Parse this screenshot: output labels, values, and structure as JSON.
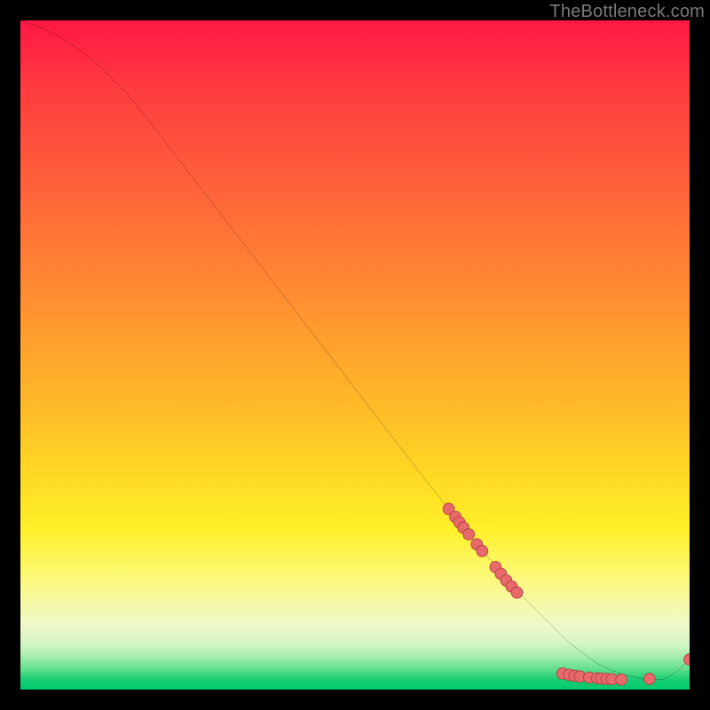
{
  "watermark": "TheBottleneck.com",
  "colors": {
    "background": "#000000",
    "curve": "#000000",
    "marker_fill": "#e86a6a",
    "marker_stroke": "#b04343"
  },
  "chart_data": {
    "type": "line",
    "title": "",
    "xlabel": "",
    "ylabel": "",
    "xlim": [
      0,
      100
    ],
    "ylim": [
      0,
      100
    ],
    "grid": false,
    "legend": false,
    "series": [
      {
        "name": "bottleneck-curve",
        "x": [
          0,
          3,
          6,
          9,
          12,
          16,
          20,
          25,
          30,
          35,
          40,
          45,
          50,
          55,
          60,
          64,
          68,
          71,
          74,
          77,
          80,
          82,
          84,
          86,
          88,
          90,
          92,
          94,
          96,
          98,
          100
        ],
        "y": [
          100,
          99,
          97.5,
          95.5,
          93,
          89,
          84,
          77.5,
          71,
          64.5,
          58,
          51.5,
          45,
          38.5,
          32,
          27,
          22,
          18.5,
          15,
          12,
          9,
          7,
          5.5,
          4,
          3,
          2.3,
          1.8,
          1.5,
          1.5,
          2.6,
          4.5
        ]
      }
    ],
    "markers": {
      "name": "highlighted-points",
      "points": [
        {
          "x": 64,
          "y": 27
        },
        {
          "x": 65,
          "y": 25.8
        },
        {
          "x": 65.6,
          "y": 25
        },
        {
          "x": 66.2,
          "y": 24.2
        },
        {
          "x": 67,
          "y": 23.2
        },
        {
          "x": 68.2,
          "y": 21.7
        },
        {
          "x": 69,
          "y": 20.7
        },
        {
          "x": 71,
          "y": 18.3
        },
        {
          "x": 71.8,
          "y": 17.3
        },
        {
          "x": 72.6,
          "y": 16.3
        },
        {
          "x": 73.4,
          "y": 15.4
        },
        {
          "x": 74.2,
          "y": 14.5
        },
        {
          "x": 81,
          "y": 2.4
        },
        {
          "x": 82,
          "y": 2.2
        },
        {
          "x": 82.8,
          "y": 2.05
        },
        {
          "x": 83.6,
          "y": 1.95
        },
        {
          "x": 85,
          "y": 1.8
        },
        {
          "x": 86.2,
          "y": 1.7
        },
        {
          "x": 86.8,
          "y": 1.65
        },
        {
          "x": 87.6,
          "y": 1.6
        },
        {
          "x": 88.4,
          "y": 1.55
        },
        {
          "x": 89.8,
          "y": 1.5
        },
        {
          "x": 94,
          "y": 1.6
        },
        {
          "x": 100,
          "y": 4.5
        }
      ]
    }
  }
}
